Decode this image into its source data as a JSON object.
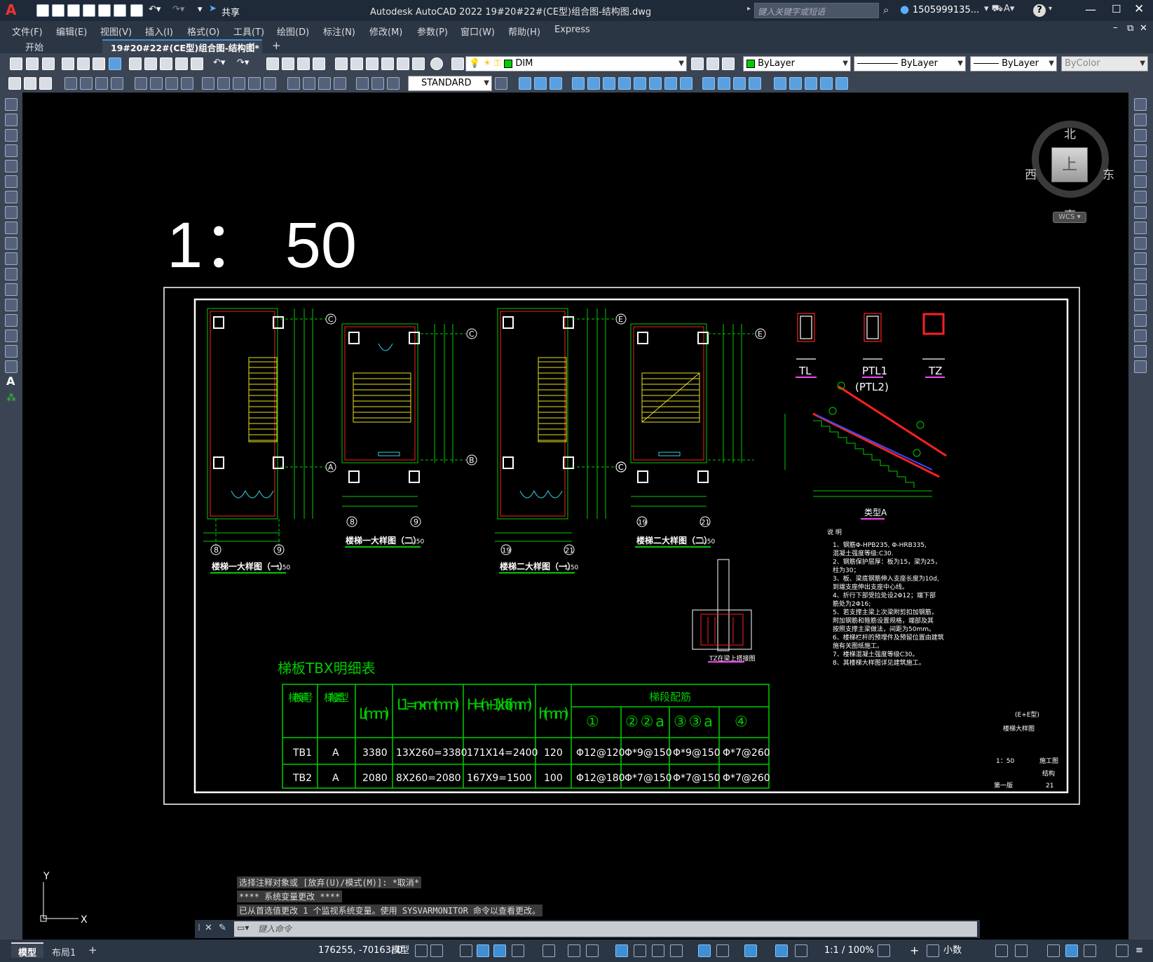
{
  "title_bar": {
    "app_logo": "A",
    "share_label": "共享",
    "title": "Autodesk AutoCAD 2022    19#20#22#(CE型)组合图-结构图.dwg",
    "search_placeholder": "键入关键字或短语",
    "user": "1505999135...",
    "help": "?"
  },
  "menu": {
    "items": [
      "文件(F)",
      "编辑(E)",
      "视图(V)",
      "插入(I)",
      "格式(O)",
      "工具(T)",
      "绘图(D)",
      "标注(N)",
      "修改(M)",
      "参数(P)",
      "窗口(W)",
      "帮助(H)",
      "Express"
    ]
  },
  "tabs": {
    "start": "开始",
    "active": "19#20#22#(CE型)组合图-结构图*",
    "add": "+"
  },
  "toolbar": {
    "layer": "DIM",
    "color": "ByLayer",
    "linetype": "ByLayer",
    "lineweight": "ByLayer",
    "plotstyle": "ByColor",
    "textstyle": "STANDARD"
  },
  "viewcube": {
    "north": "北",
    "south": "南",
    "east": "东",
    "west": "西",
    "face": "上",
    "wcs": "WCS"
  },
  "drawing": {
    "scale_text": "1： 50",
    "sheet_titles": [
      "楼梯一大样图（一）",
      "楼梯一大样图（二）",
      "楼梯二大样图（一）",
      "楼梯二大样图（二）"
    ],
    "scale_suffix": "1:50",
    "grid_labels": [
      "C",
      "A",
      "C",
      "B",
      "E",
      "C",
      "E",
      "C",
      "8",
      "9",
      "8",
      "9",
      "19",
      "21",
      "19",
      "21"
    ],
    "section_labels": [
      "TL",
      "PTL1",
      "(PTL2)",
      "TZ",
      "类型A",
      "TZ在梁上搭接图"
    ],
    "notes_title": "说  明",
    "notes": [
      "1、钢筋Φ-HPB235, Φ-HRB335,",
      "   混凝土强度等级:C30.",
      "2、钢筋保护层厚：板为15，梁为25，",
      "   柱为30；",
      "3、板、梁底钢筋伸入支座长度为10d,",
      "   到端支座伸出支座中心线。",
      "4、折行下部受拉处设2Φ12；端下部",
      "   筋处为2Φ16;",
      "5、若支撑主梁上次梁附剪扣加钢筋，",
      "   附加钢筋和箍筋设置规格，端部及其",
      "   按照支撑主梁做法，间距为50mm。",
      "6、楼梯栏杆的预埋件及预留位置由建筑",
      "   施有关图纸施工。",
      "7、楼梯混凝土强度等级C30。",
      "8、其楼梯大样图详见建筑施工。"
    ],
    "title_block": {
      "project": "(E+E型)",
      "drawing_name": "楼梯大样图",
      "scale": "1：50",
      "stage": "施工图",
      "discipline": "结构",
      "edition": "第一版",
      "number": "21"
    },
    "table_title": "梯板TBX明细表",
    "table_headers": {
      "col1": "梯 板 编 号",
      "col2": "梯 段 类 型",
      "col3": "L (mm)",
      "col4": "L1=nxm (mm)",
      "col5": "H=(n+1)xhδ (mm)",
      "col6": "h (mm)",
      "group": "梯段配筋",
      "sub": [
        "①",
        "②②a",
        "③③a",
        "④"
      ]
    },
    "table_rows": [
      [
        "TB1",
        "A",
        "3380",
        "13X260=3380",
        "171X14=2400",
        "120",
        "Φ12@120",
        "Φ*9@150",
        "Φ*9@150",
        "Φ*7@260"
      ],
      [
        "TB2",
        "A",
        "2080",
        "8X260=2080",
        "167X9=1500",
        "100",
        "Φ12@180",
        "Φ*7@150",
        "Φ*7@150",
        "Φ*7@260"
      ]
    ],
    "ucs": {
      "y": "Y",
      "x": "X"
    }
  },
  "command": {
    "history": [
      "选择注释对象或 [放弃(U)/模式(M)]: *取消*",
      "**** 系统变量更改 ****",
      "已从首选值更改 1 个监视系统变量。使用 SYSVARMONITOR 命令以查看更改。"
    ],
    "placeholder": "键入命令"
  },
  "status": {
    "tabs": [
      "模型",
      "布局1",
      "+"
    ],
    "coords": "176255, -70163, 0",
    "mode": "模型",
    "annot_scale": "1:1 / 100%",
    "units": "小数"
  },
  "colors": {
    "accent": "#3d8fd6",
    "drawing_green": "#00cc00",
    "wall_red": "#ff2020",
    "yellow": "#e8e020"
  }
}
